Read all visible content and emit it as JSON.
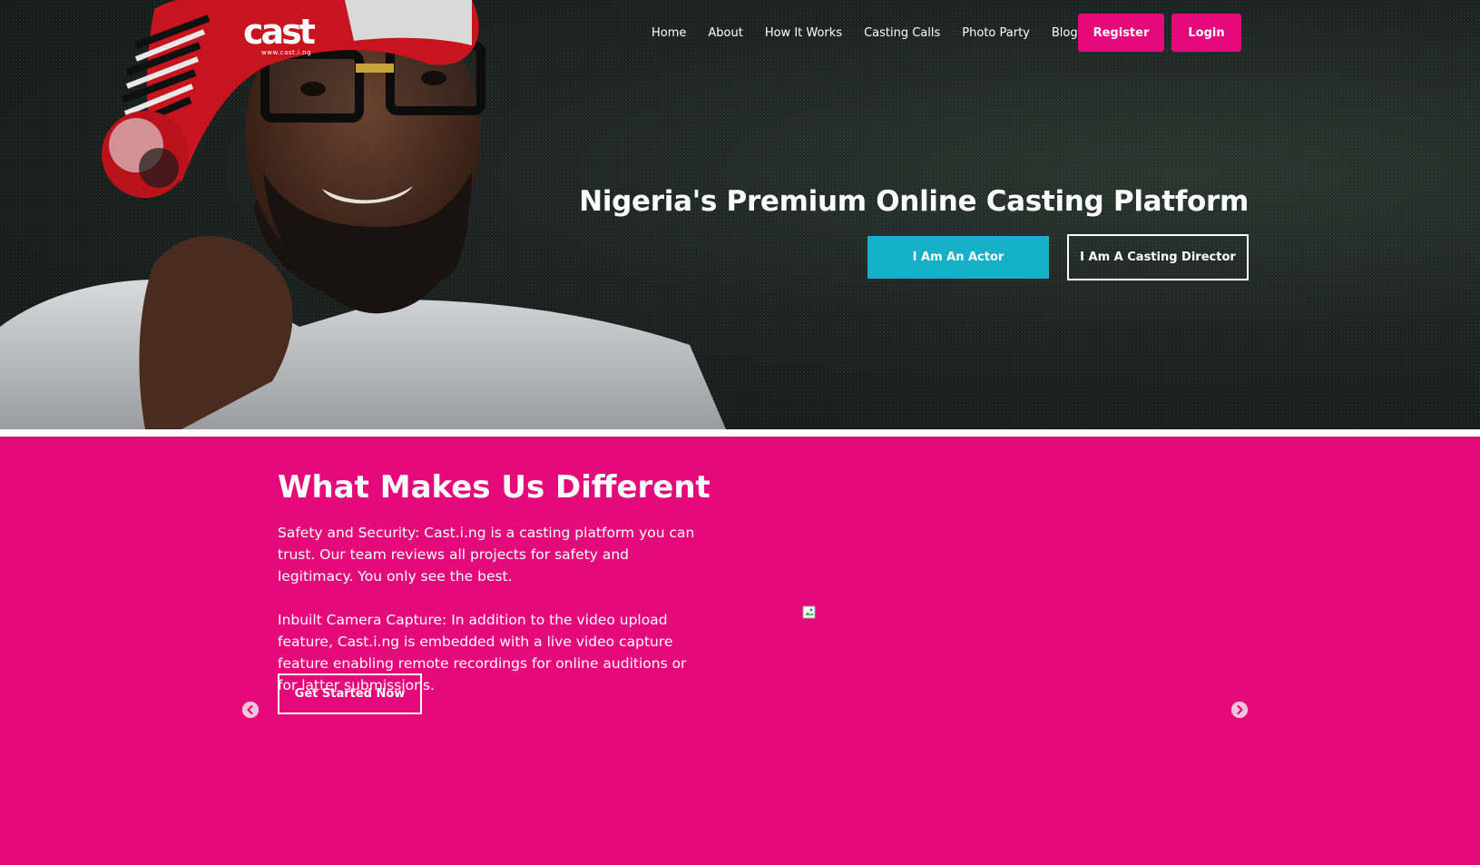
{
  "brand": {
    "logo_text": "cast",
    "logo_subtext": "www.cast.i.ng"
  },
  "nav": {
    "links": [
      "Home",
      "About",
      "How It Works",
      "Casting Calls",
      "Photo Party",
      "Blog"
    ],
    "register_label": "Register",
    "login_label": "Login"
  },
  "hero": {
    "title": "Nigeria's Premium Online Casting Platform",
    "actor_button": "I Am An Actor",
    "director_button": "I Am A Casting Director"
  },
  "different": {
    "title": "What Makes Us Different",
    "paragraphs": [
      "Safety and Security: Cast.i.ng is a casting platform you can trust. Our team reviews all projects for safety and legitimacy. You only see the best.",
      "Inbuilt Camera Capture: In addition to the video upload feature, Cast.i.ng is embedded with a live video capture feature enabling remote recordings for online auditions or for latter submissions."
    ],
    "cta_label": "Get Started Now"
  },
  "colors": {
    "pink": "#e50a7a",
    "teal": "#17b0c9",
    "hero_dark": "#1b2421"
  },
  "icons": {
    "prev": "chevron-left-circle-icon",
    "next": "chevron-right-circle-icon",
    "image": "broken-image-icon"
  }
}
